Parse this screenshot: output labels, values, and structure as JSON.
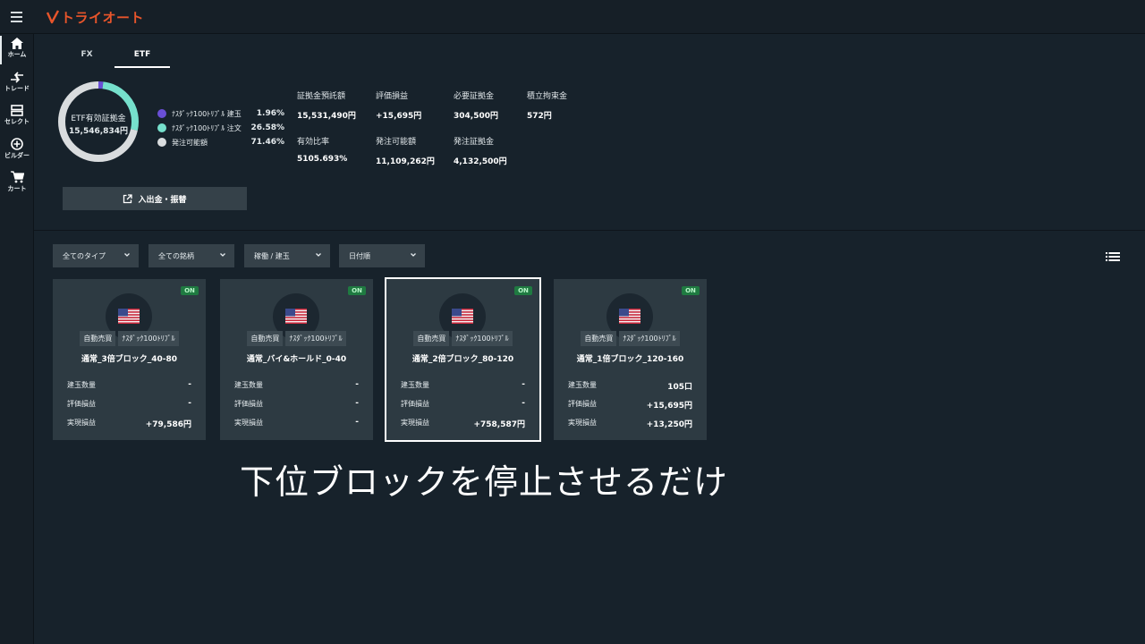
{
  "app": {
    "logo_text": "トライオート",
    "brand_color": "#e8552b"
  },
  "sidebar": {
    "items": [
      {
        "label": "ホーム",
        "icon": "home-icon"
      },
      {
        "label": "トレード",
        "icon": "trade-arrows-icon"
      },
      {
        "label": "セレクト",
        "icon": "select-icon"
      },
      {
        "label": "ビルダー",
        "icon": "builder-plus-icon"
      },
      {
        "label": "カート",
        "icon": "cart-icon"
      }
    ]
  },
  "tabs": [
    {
      "label": "FX"
    },
    {
      "label": "ETF"
    }
  ],
  "summary": {
    "donut_title": "ETF有効証拠金",
    "donut_amount": "15,546,834円",
    "legend": [
      {
        "name": "ﾅｽﾀﾞｯｸ100ﾄﾘﾌﾟﾙ 建玉",
        "value": "1.96%",
        "percent": 1.96,
        "color": "#6a4fd6"
      },
      {
        "name": "ﾅｽﾀﾞｯｸ100ﾄﾘﾌﾟﾙ 注文",
        "value": "26.58%",
        "percent": 26.58,
        "color": "#76e0cc"
      },
      {
        "name": "発注可能額",
        "value": "71.46%",
        "percent": 71.46,
        "color": "#d9dcde"
      }
    ],
    "stats": [
      {
        "label": "証拠金預託額",
        "value": "15,531,490円"
      },
      {
        "label": "評価損益",
        "value": "+15,695円"
      },
      {
        "label": "必要証拠金",
        "value": "304,500円"
      },
      {
        "label": "積立拘束金",
        "value": "572円"
      },
      {
        "label": "有効比率",
        "value": "5105.693%"
      },
      {
        "label": "発注可能額",
        "value": "11,109,262円"
      },
      {
        "label": "発注証拠金",
        "value": "4,132,500円"
      }
    ],
    "deposit_button": "入出金・振替"
  },
  "filters": [
    {
      "label": "全てのタイプ"
    },
    {
      "label": "全ての銘柄"
    },
    {
      "label": "稼働 / 建玉"
    },
    {
      "label": "日付順"
    }
  ],
  "cards": [
    {
      "status": "ON",
      "type_tag": "自動売買",
      "currency_tag": "ﾅｽﾀﾞｯｸ100ﾄﾘﾌﾟﾙ",
      "name": "通常_3倍ブロック_40-80",
      "rows": [
        {
          "k": "建玉数量",
          "v": "-"
        },
        {
          "k": "評価損益",
          "v": "-"
        },
        {
          "k": "実現損益",
          "v": "+79,586円"
        }
      ]
    },
    {
      "status": "ON",
      "type_tag": "自動売買",
      "currency_tag": "ﾅｽﾀﾞｯｸ100ﾄﾘﾌﾟﾙ",
      "name": "通常_バイ&ホールド_0-40",
      "rows": [
        {
          "k": "建玉数量",
          "v": "-"
        },
        {
          "k": "評価損益",
          "v": "-"
        },
        {
          "k": "実現損益",
          "v": "-"
        }
      ]
    },
    {
      "status": "ON",
      "type_tag": "自動売買",
      "currency_tag": "ﾅｽﾀﾞｯｸ100ﾄﾘﾌﾟﾙ",
      "name": "通常_2倍ブロック_80-120",
      "rows": [
        {
          "k": "建玉数量",
          "v": "-"
        },
        {
          "k": "評価損益",
          "v": "-"
        },
        {
          "k": "実現損益",
          "v": "+758,587円"
        }
      ]
    },
    {
      "status": "ON",
      "type_tag": "自動売買",
      "currency_tag": "ﾅｽﾀﾞｯｸ100ﾄﾘﾌﾟﾙ",
      "name": "通常_1倍ブロック_120-160",
      "rows": [
        {
          "k": "建玉数量",
          "v": "105口"
        },
        {
          "k": "評価損益",
          "v": "+15,695円"
        },
        {
          "k": "実現損益",
          "v": "+13,250円"
        }
      ]
    }
  ],
  "caption": "下位ブロックを停止させるだけ"
}
